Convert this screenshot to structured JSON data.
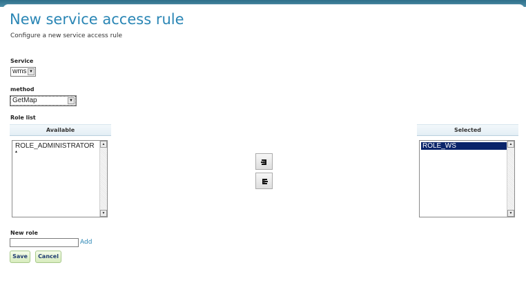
{
  "page": {
    "title": "New service access rule",
    "subtitle": "Configure a new service access rule"
  },
  "service": {
    "label": "Service",
    "selected": "wms"
  },
  "method": {
    "label": "method",
    "selected": "GetMap"
  },
  "roles": {
    "label": "Role list",
    "available_header": "Available",
    "selected_header": "Selected",
    "available_items": [
      "ROLE_ADMINISTRATOR"
    ],
    "selected_items": [
      "ROLE_WS"
    ]
  },
  "new_role": {
    "label": "New role",
    "value": "",
    "add_label": "Add"
  },
  "actions": {
    "save_label": "Save",
    "cancel_label": "Cancel"
  },
  "colors": {
    "accent": "#2a86b5",
    "selection": "#0a246a",
    "button_green": "#d7ecbd"
  }
}
